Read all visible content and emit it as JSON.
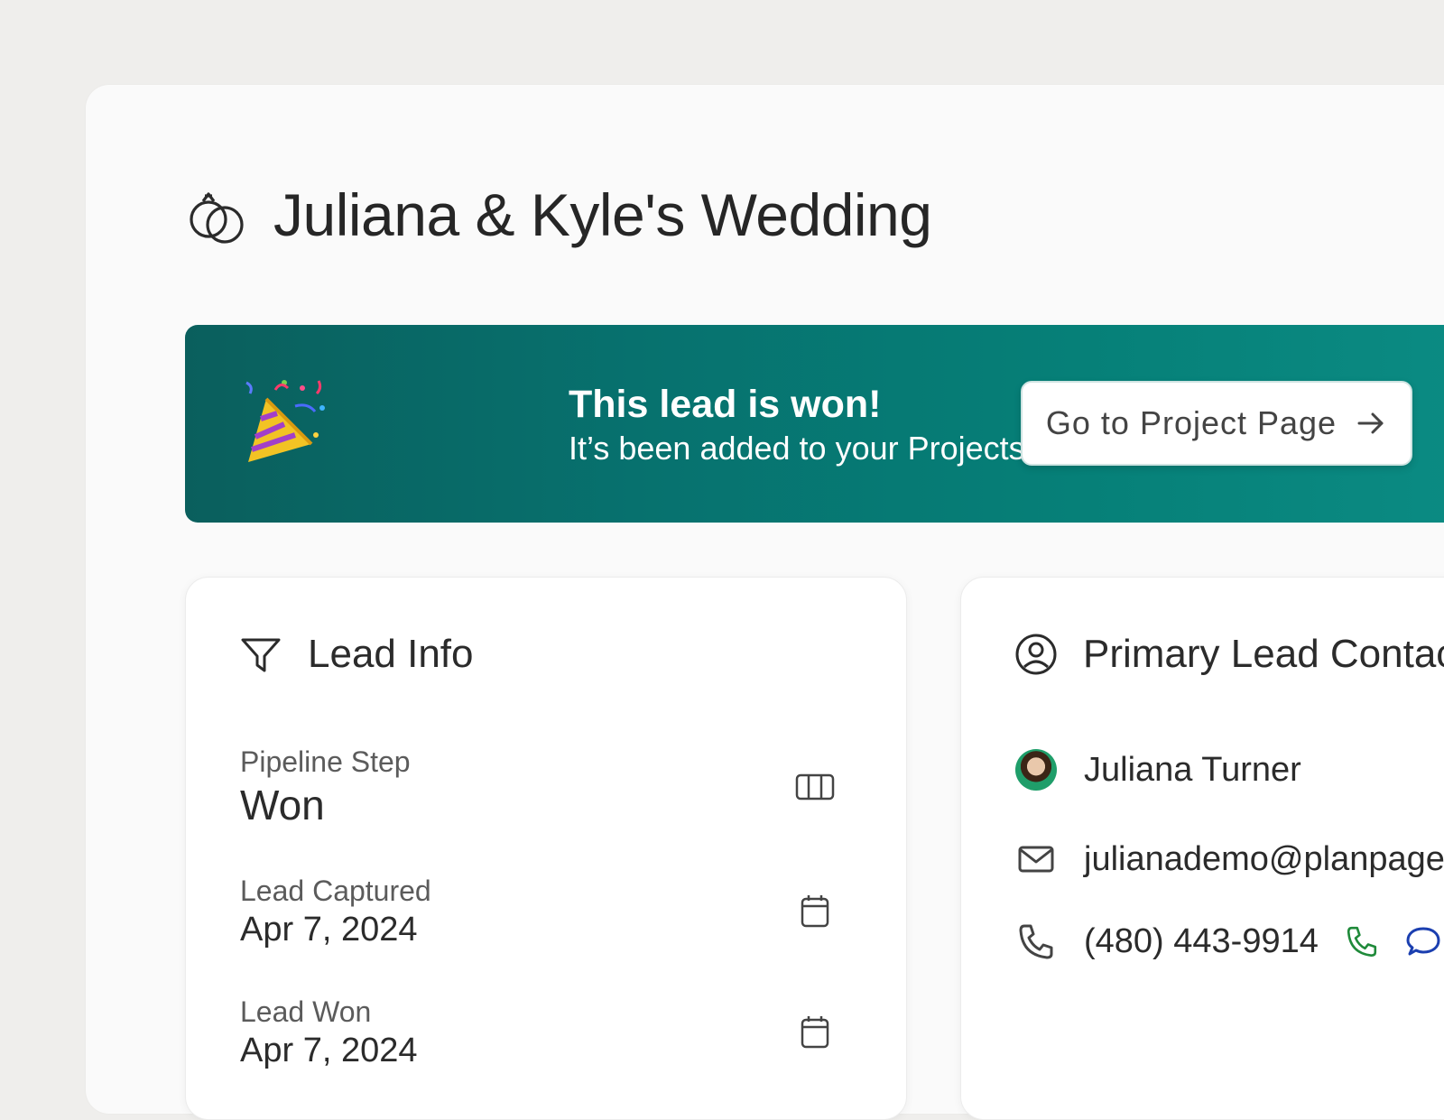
{
  "project": {
    "title": "Juliana & Kyle's Wedding",
    "icon": "wedding-rings-icon"
  },
  "banner": {
    "heading": "This lead is won!",
    "subtext": "It’s been added to your Projects.",
    "button_label": "Go to Project Page",
    "icon": "party-popper-icon"
  },
  "lead_info": {
    "title": "Lead Info",
    "fields": [
      {
        "label": "Pipeline Step",
        "value": "Won",
        "icon": "board-columns-icon"
      },
      {
        "label": "Lead Captured",
        "value": "Apr 7, 2024",
        "icon": "calendar-icon"
      },
      {
        "label": "Lead Won",
        "value": "Apr 7, 2024",
        "icon": "calendar-icon"
      }
    ]
  },
  "primary_contact": {
    "title": "Primary Lead Contac",
    "name": "Juliana Turner",
    "email": "julianademo@planpage.c",
    "phone": "(480) 443-9914"
  },
  "colors": {
    "banner_start": "#0a5f5d",
    "banner_end": "#0b8b83",
    "call_green": "#1f8a3a",
    "message_blue": "#1b3fb0"
  }
}
